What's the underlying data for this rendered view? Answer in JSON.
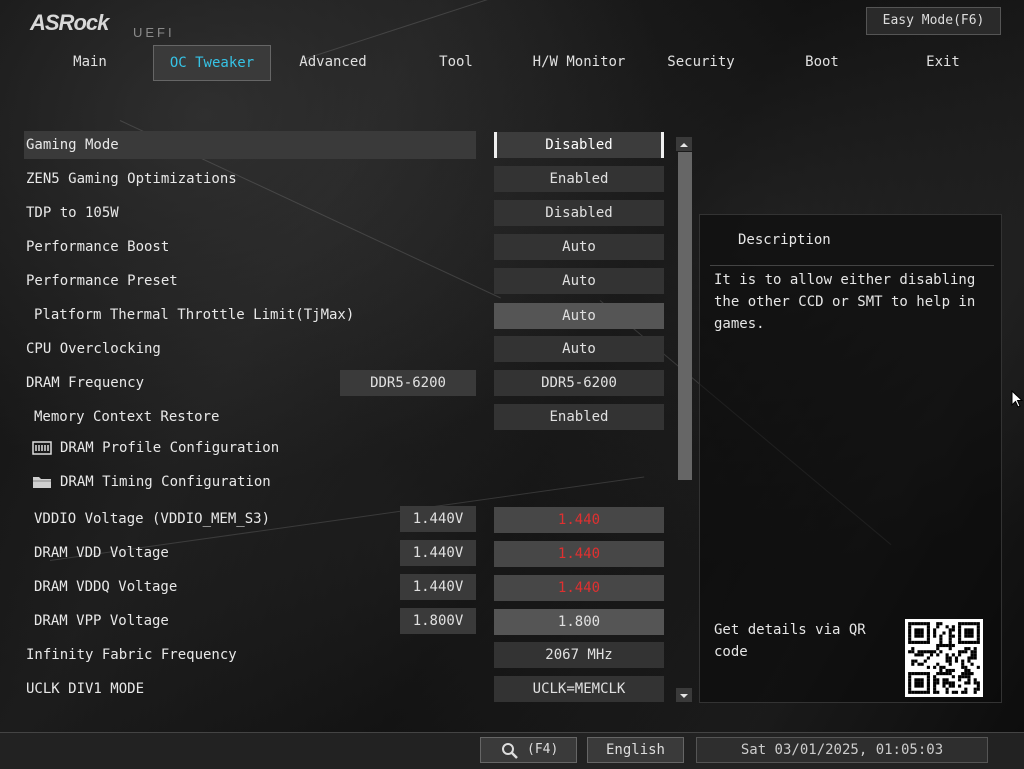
{
  "header": {
    "logo": "ASRock",
    "uefi": "UEFI",
    "easy_mode": "Easy Mode(F6)"
  },
  "tabs": [
    {
      "label": "Main"
    },
    {
      "label": "OC Tweaker",
      "active": true
    },
    {
      "label": "Advanced"
    },
    {
      "label": "Tool"
    },
    {
      "label": "H/W Monitor"
    },
    {
      "label": "Security"
    },
    {
      "label": "Boot"
    },
    {
      "label": "Exit"
    }
  ],
  "settings": [
    {
      "label": "Gaming Mode",
      "value": "Disabled"
    },
    {
      "label": "ZEN5 Gaming Optimizations",
      "value": "Enabled"
    },
    {
      "label": "TDP to 105W",
      "value": "Disabled"
    },
    {
      "label": "Performance Boost",
      "value": "Auto"
    },
    {
      "label": "Performance Preset",
      "value": "Auto"
    },
    {
      "label": "Platform Thermal Throttle Limit(TjMax)",
      "value": "Auto"
    },
    {
      "label": "CPU Overclocking",
      "value": "Auto"
    },
    {
      "label": "DRAM Frequency",
      "current": "DDR5-6200",
      "value": "DDR5-6200"
    },
    {
      "label": "Memory Context Restore",
      "value": "Enabled"
    },
    {
      "label": "DRAM Profile Configuration",
      "icon": "memory-icon"
    },
    {
      "label": "DRAM Timing Configuration",
      "icon": "folder-icon"
    },
    {
      "label": "VDDIO Voltage (VDDIO_MEM_S3)",
      "current": "1.440V",
      "value": "1.440"
    },
    {
      "label": "DRAM VDD Voltage",
      "current": "1.440V",
      "value": "1.440"
    },
    {
      "label": "DRAM VDDQ Voltage",
      "current": "1.440V",
      "value": "1.440"
    },
    {
      "label": "DRAM VPP Voltage",
      "current": "1.800V",
      "value": "1.800"
    },
    {
      "label": "Infinity Fabric Frequency",
      "value": "2067 MHz"
    },
    {
      "label": "UCLK DIV1 MODE",
      "value": "UCLK=MEMCLK"
    }
  ],
  "description": {
    "title": "Description",
    "text": "It is to allow either disabling the other CCD or SMT to help in games.",
    "qr_text": "Get details via QR code"
  },
  "footer": {
    "search_label": "(F4)",
    "language": "English",
    "datetime": "Sat 03/01/2025, 01:05:03"
  },
  "colors": {
    "accent": "#36c3e6",
    "warning_value": "#e03030"
  }
}
